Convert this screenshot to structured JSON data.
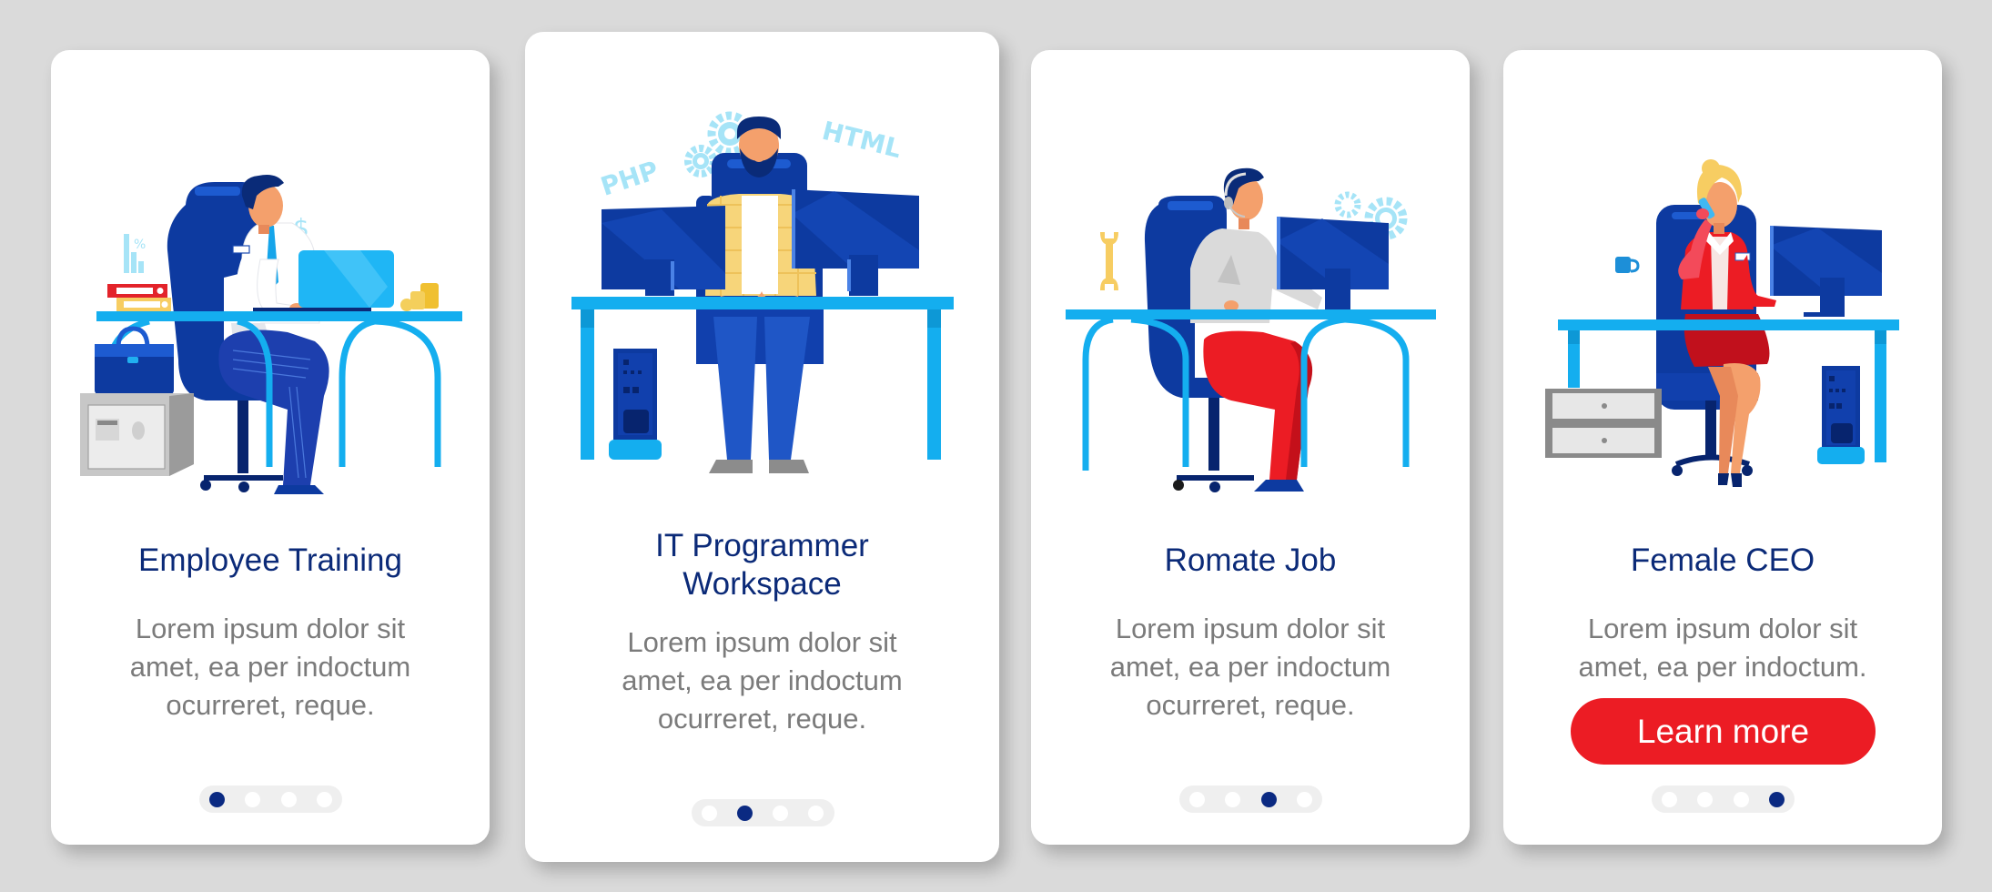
{
  "colors": {
    "background": "#dadada",
    "card": "#ffffff",
    "title": "#0b2a78",
    "body_text": "#7b7b7b",
    "dot_active": "#0b2a82",
    "dot_inactive": "#ffffff",
    "pager_bg": "#efefef",
    "cta": "#ec1c24",
    "desk": "#14aeef",
    "chair": "#0d3aa0"
  },
  "cards": [
    {
      "title_lines": [
        "Employee Training"
      ],
      "body_lines": [
        "Lorem ipsum dolor sit",
        "amet, ea per indoctum",
        "ocurreret, reque."
      ],
      "illustration": "businessman-at-laptop-desk",
      "decor_labels": [
        "%",
        "$"
      ],
      "page_index": 0,
      "page_count": 4
    },
    {
      "title_lines": [
        "IT Programmer",
        "Workspace"
      ],
      "body_lines": [
        "Lorem ipsum dolor sit",
        "amet, ea per indoctum",
        "ocurreret, reque."
      ],
      "illustration": "programmer-dual-monitors",
      "decor_labels": [
        "PHP",
        "HTML"
      ],
      "page_index": 1,
      "page_count": 4
    },
    {
      "title_lines": [
        "Romate Job"
      ],
      "body_lines": [
        "Lorem ipsum dolor sit",
        "amet, ea per indoctum",
        "ocurreret, reque."
      ],
      "illustration": "support-agent-headset-monitor",
      "decor_labels": [],
      "page_index": 2,
      "page_count": 4
    },
    {
      "title_lines": [
        "Female CEO"
      ],
      "body_lines": [
        "Lorem ipsum dolor sit",
        "amet, ea per indoctum."
      ],
      "illustration": "businesswoman-on-phone-at-desk",
      "decor_labels": [],
      "page_index": 3,
      "page_count": 4,
      "cta_label": "Learn more"
    }
  ]
}
